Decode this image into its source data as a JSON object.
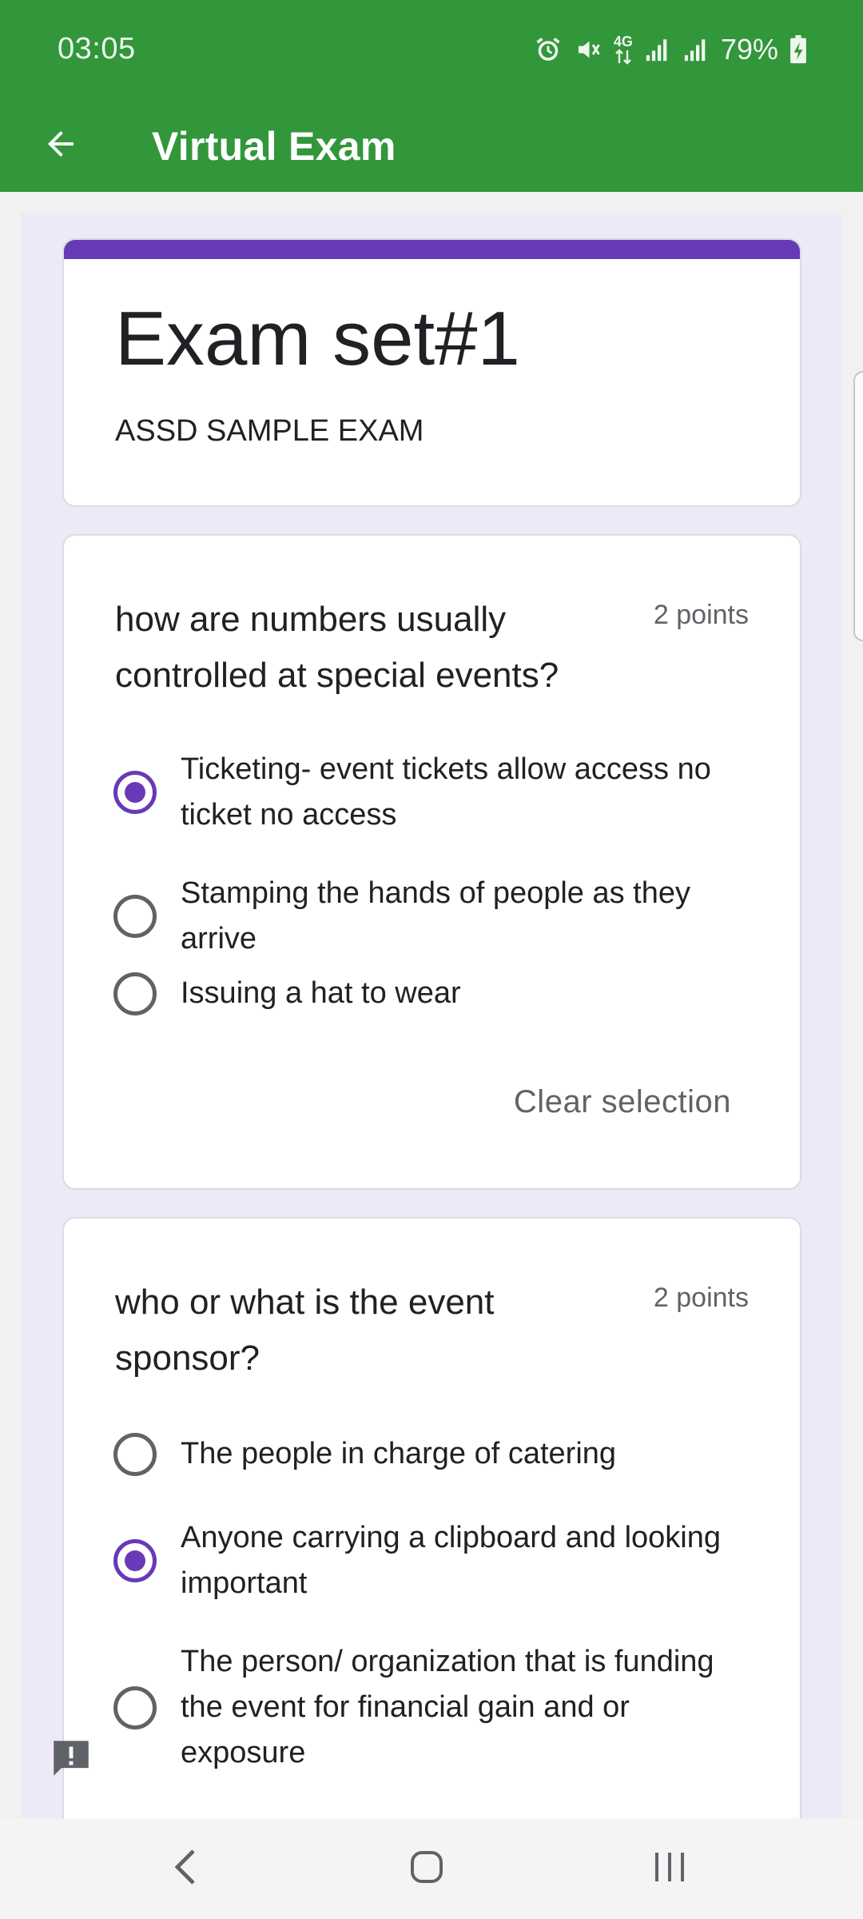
{
  "status_bar": {
    "time": "03:05",
    "network_label": "4G",
    "battery": "79%",
    "icons": [
      "alarm-icon",
      "mute-icon",
      "data-icon",
      "signal-icon",
      "signal-icon",
      "battery-charging-icon"
    ]
  },
  "app_bar": {
    "title": "Virtual Exam",
    "back_icon": "arrow-back-icon"
  },
  "form": {
    "accent_color": "#673ab7",
    "title": "Exam set#1",
    "description": "ASSD SAMPLE EXAM",
    "questions": [
      {
        "title": "how are numbers usually controlled at special events?",
        "points": "2 points",
        "options": [
          "Ticketing- event tickets allow access no ticket no access",
          "Stamping the hands of people as they arrive",
          "Issuing a hat to wear"
        ],
        "selected": "Ticketing- event tickets allow access no ticket no access",
        "clear_label": "Clear selection"
      },
      {
        "title": "who or what is the event sponsor?",
        "points": "2 points",
        "options": [
          "The people in charge of catering",
          "Anyone carrying a clipboard and looking important",
          "The person/ organization that is funding the event for financial gain and or exposure"
        ],
        "selected": "Anyone carrying a clipboard and looking important"
      }
    ]
  },
  "colors": {
    "app_bar": "#32963a",
    "form_background": "#ede9f7",
    "accent": "#673ab7"
  },
  "nav_bar": {
    "buttons": [
      "nav-back-icon",
      "nav-home-icon",
      "nav-recents-icon"
    ]
  }
}
